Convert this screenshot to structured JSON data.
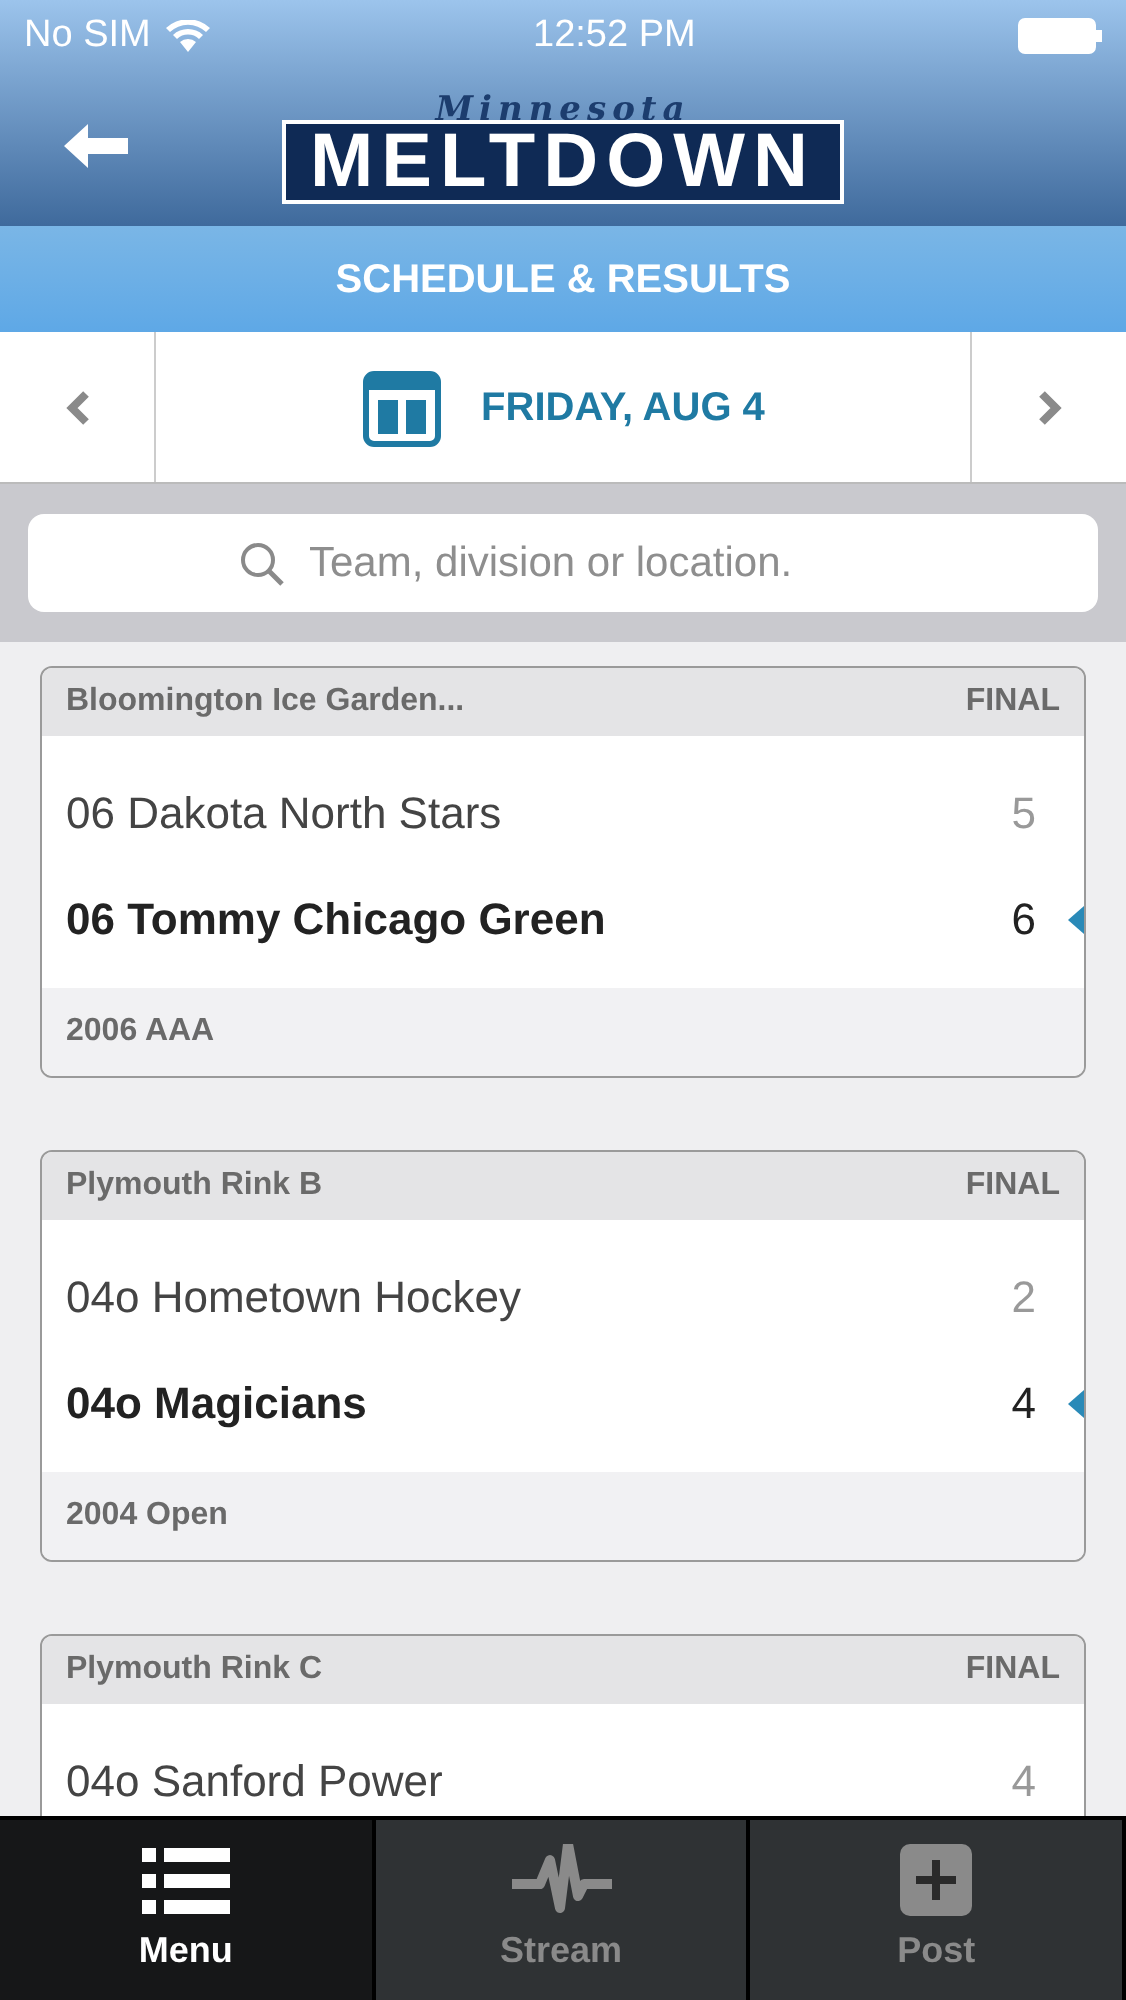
{
  "status_bar": {
    "carrier": "No SIM",
    "time": "12:52 PM"
  },
  "header": {
    "logo_script": "Minnesota",
    "logo_main": "MELTDOWN"
  },
  "section_title": "SCHEDULE & RESULTS",
  "date_nav": {
    "label": "FRIDAY, AUG 4"
  },
  "search": {
    "placeholder": "Team, division or location."
  },
  "games": [
    {
      "location": "Bloomington Ice Garden...",
      "status": "FINAL",
      "teams": [
        {
          "name": "06 Dakota North Stars",
          "score": "5",
          "winner": false
        },
        {
          "name": "06 Tommy Chicago Green",
          "score": "6",
          "winner": true
        }
      ],
      "division": "2006 AAA"
    },
    {
      "location": "Plymouth Rink B",
      "status": "FINAL",
      "teams": [
        {
          "name": "04o Hometown Hockey",
          "score": "2",
          "winner": false
        },
        {
          "name": "04o Magicians",
          "score": "4",
          "winner": true
        }
      ],
      "division": "2004 Open"
    },
    {
      "location": "Plymouth Rink C",
      "status": "FINAL",
      "teams": [
        {
          "name": "04o Sanford Power",
          "score": "4",
          "winner": false
        }
      ]
    }
  ],
  "tab_bar": [
    {
      "label": "Menu",
      "kind": "menu",
      "selected": true
    },
    {
      "label": "Stream",
      "kind": "stream",
      "selected": false
    },
    {
      "label": "Post",
      "kind": "post",
      "selected": false
    }
  ]
}
